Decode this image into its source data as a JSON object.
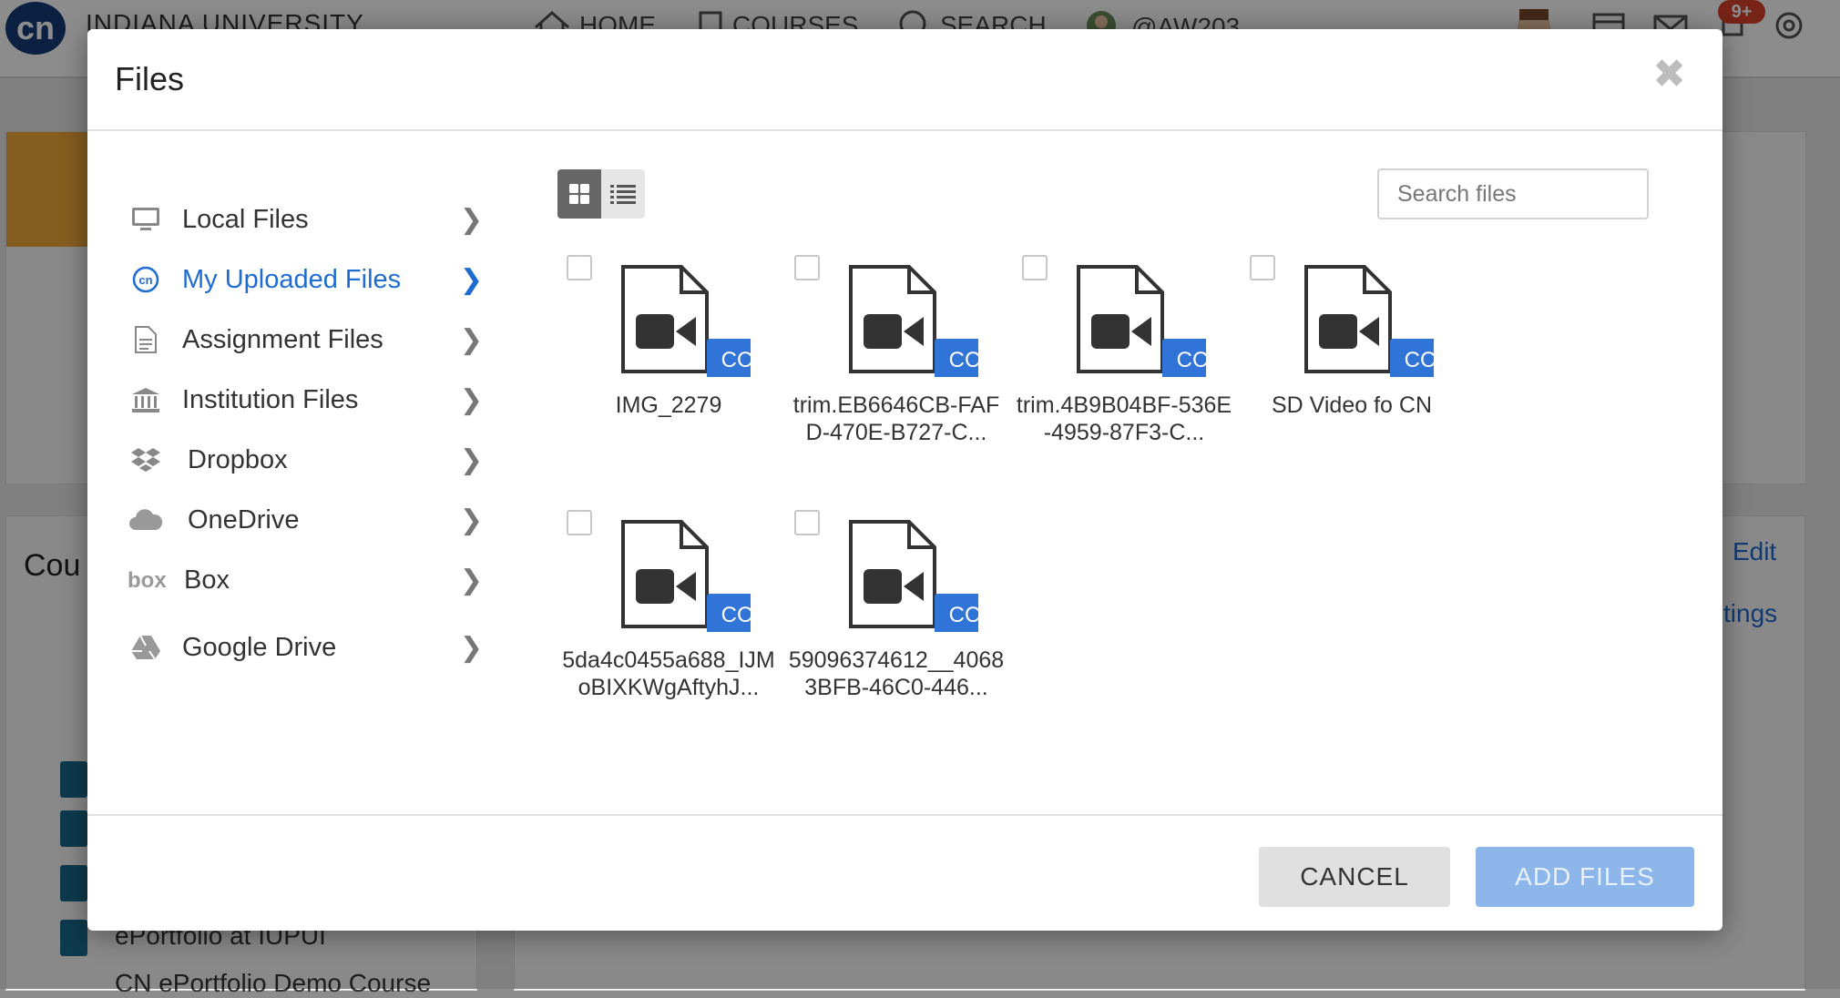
{
  "background": {
    "university": "INDIANA UNIVERSITY",
    "nav": [
      {
        "label": "HOME",
        "icon": "home-icon"
      },
      {
        "label": "COURSES",
        "icon": "courses-icon"
      },
      {
        "label": "SEARCH",
        "icon": "search-icon"
      },
      {
        "label": "@AW203",
        "icon": "user-avatar-icon"
      }
    ],
    "notification_count": "9+",
    "section_title": "Cou",
    "edit_link": "Edit",
    "settings_link": "tings",
    "course_items": [
      "ePortfolio at IUPUI",
      "CN ePortfolio Demo Course"
    ]
  },
  "modal": {
    "title": "Files",
    "close_glyph": "✖",
    "sidebar": [
      {
        "label": "Local Files",
        "icon": "monitor-icon",
        "active": false
      },
      {
        "label": "My Uploaded Files",
        "icon": "cn-logo-icon",
        "active": true
      },
      {
        "label": "Assignment Files",
        "icon": "document-icon",
        "active": false
      },
      {
        "label": "Institution Files",
        "icon": "institution-icon",
        "active": false
      },
      {
        "label": "Dropbox",
        "icon": "dropbox-icon",
        "active": false
      },
      {
        "label": "OneDrive",
        "icon": "cloud-icon",
        "active": false
      },
      {
        "label": "Box",
        "icon": "box-logo-icon",
        "active": false
      },
      {
        "label": "Google Drive",
        "icon": "google-drive-icon",
        "active": false
      }
    ],
    "view_mode": "grid",
    "search_placeholder": "Search files",
    "files": [
      {
        "name": "IMG_2279",
        "badge": "CC"
      },
      {
        "name": "trim.EB6646CB-FAFD-470E-B727-C...",
        "badge": "CC"
      },
      {
        "name": "trim.4B9B04BF-536E-4959-87F3-C...",
        "badge": "CC"
      },
      {
        "name": "SD Video fo CN",
        "badge": "CC"
      },
      {
        "name": "5da4c0455a688_IJMoBIXKWgAftyhJ...",
        "badge": "CC"
      },
      {
        "name": "59096374612__40683BFB-46C0-446...",
        "badge": "CC"
      }
    ],
    "cancel_label": "CANCEL",
    "add_label": "ADD FILES"
  },
  "colors": {
    "accent": "#1f6cd1",
    "badge": "#1f6cd1",
    "add_disabled": "#8db6ea"
  }
}
